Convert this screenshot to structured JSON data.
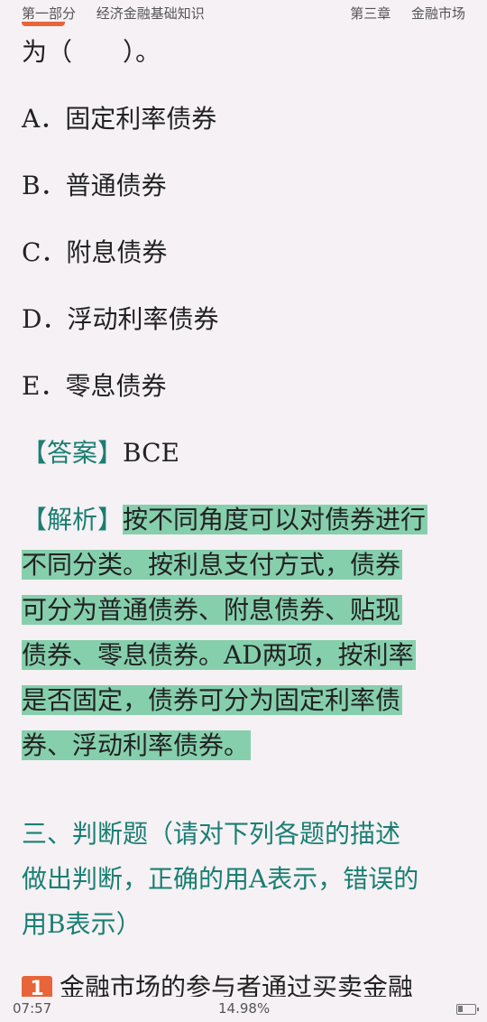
{
  "header": {
    "part": "第一部分",
    "book": "经济金融基础知识",
    "chapter": "第三章",
    "chapter_title": "金融市场"
  },
  "question": {
    "stem_tail": "为（　　）。",
    "options": [
      "A．固定利率债券",
      "B．普通债券",
      "C．附息债券",
      "D．浮动利率债券",
      "E．零息债券"
    ],
    "answer_tag": "【答案】",
    "answer_value": "BCE",
    "analysis_tag": "【解析】",
    "analysis_lines": [
      "按不同角度可以对债券进行",
      "不同分类。按利息支付方式，债券",
      "可分为普通债券、附息债券、贴现",
      "债券、零息债券。AD两项，按利率",
      "是否固定，债券可分为固定利率债",
      "券、浮动利率债券。"
    ]
  },
  "section": {
    "lines": [
      "三、判断题（请对下列各题的描述",
      "做出判断，正确的用A表示，错误的",
      "用B表示）"
    ]
  },
  "next_question": {
    "number": "1",
    "text": "金融市场的参与者通过买卖金融"
  },
  "status": {
    "time": "07:57",
    "progress": "14.98%",
    "battery_level": 0.3
  },
  "colors": {
    "accent": "#e8653a",
    "teal": "#1a7f73",
    "highlight": "#86cfad",
    "background": "#f6f1f4"
  }
}
